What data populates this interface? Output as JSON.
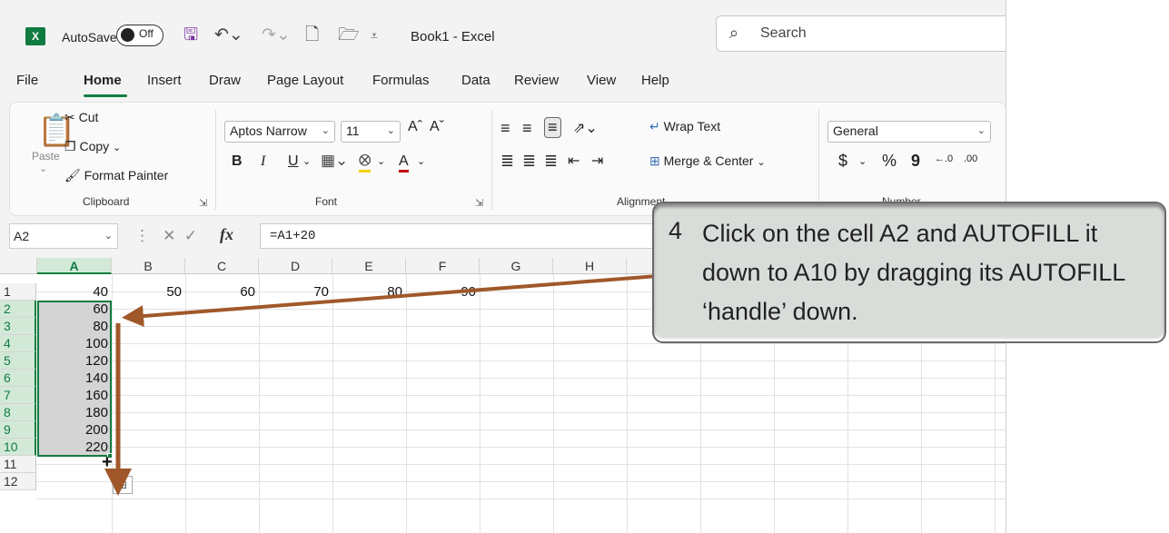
{
  "titlebar": {
    "app_icon": "X",
    "autosave_label": "AutoSave",
    "autosave_state": "Off",
    "book_title": "Book1  -  Excel",
    "search_placeholder": "Search"
  },
  "menu": [
    "File",
    "Home",
    "Insert",
    "Draw",
    "Page Layout",
    "Formulas",
    "Data",
    "Review",
    "View",
    "Help"
  ],
  "ribbon": {
    "clipboard": {
      "paste": "Paste",
      "cut": "Cut",
      "copy": "Copy",
      "format_painter": "Format Painter",
      "group_label": "Clipboard"
    },
    "font": {
      "font_name": "Aptos Narrow",
      "font_size": "11",
      "bold": "B",
      "italic": "I",
      "underline": "U",
      "font_color_glyph": "A",
      "grow": "Aˆ",
      "shrink": "Aˇ",
      "group_label": "Font"
    },
    "alignment": {
      "wrap_text": "Wrap Text",
      "merge_center": "Merge & Center",
      "group_label": "Alignment"
    },
    "number": {
      "format": "General",
      "currency": "$",
      "percent": "%",
      "comma": "9",
      "inc_dec": "←.0",
      "dec_dec": ".00",
      "group_label": "Number"
    }
  },
  "formula_bar": {
    "cell_ref": "A2",
    "fx": "fx",
    "formula": "=A1+20"
  },
  "grid": {
    "columns": [
      "A",
      "B",
      "C",
      "D",
      "E",
      "F",
      "G",
      "H"
    ],
    "rows": [
      "1",
      "2",
      "3",
      "4",
      "5",
      "6",
      "7",
      "8",
      "9",
      "10",
      "11",
      "12"
    ],
    "row1_values": [
      "40",
      "50",
      "60",
      "70",
      "80",
      "90"
    ],
    "column_a_values": [
      "60",
      "80",
      "100",
      "120",
      "140",
      "160",
      "180",
      "200",
      "220"
    ]
  },
  "callout": {
    "step": "4",
    "text": "Click on the cell A2 and AUTOFILL it down to A10 by dragging its AUTOFILL ‘handle’ down."
  },
  "colors": {
    "excel_green": "#107c41",
    "arrow": "#a0582a"
  }
}
